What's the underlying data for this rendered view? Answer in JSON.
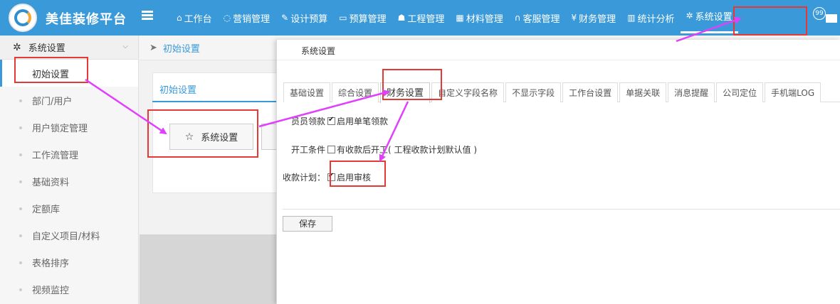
{
  "app": {
    "title": "美佳装修平台"
  },
  "nav": [
    {
      "label": "工作台",
      "icon": "home-icon",
      "glyph": "⌂"
    },
    {
      "label": "营销管理",
      "icon": "chat-icon",
      "glyph": "◌"
    },
    {
      "label": "设计预算",
      "icon": "edit-icon",
      "glyph": "✎"
    },
    {
      "label": "预算管理",
      "icon": "monitor-icon",
      "glyph": "▭"
    },
    {
      "label": "工程管理",
      "icon": "users-icon",
      "glyph": "☗"
    },
    {
      "label": "材料管理",
      "icon": "grid-icon",
      "glyph": "▦"
    },
    {
      "label": "客服管理",
      "icon": "headset-icon",
      "glyph": "∩"
    },
    {
      "label": "财务管理",
      "icon": "yen-icon",
      "glyph": "¥"
    },
    {
      "label": "统计分析",
      "icon": "bar-chart-icon",
      "glyph": "▥"
    },
    {
      "label": "系统设置",
      "icon": "gear-icon",
      "glyph": "✲"
    }
  ],
  "notifications": {
    "count": "99"
  },
  "sidebar": {
    "header": "系统设置",
    "items": [
      {
        "label": "初始设置"
      },
      {
        "label": "部门/用户"
      },
      {
        "label": "用户锁定管理"
      },
      {
        "label": "工作流管理"
      },
      {
        "label": "基础资料"
      },
      {
        "label": "定额库"
      },
      {
        "label": "自定义项目/材料"
      },
      {
        "label": "表格排序"
      },
      {
        "label": "视频监控"
      }
    ]
  },
  "breadcrumb": {
    "label": "初始设置"
  },
  "content": {
    "tab_label": "初始设置",
    "system_settings_button": "系统设置"
  },
  "modal": {
    "title": "系统设置",
    "tabs": [
      {
        "label": "基础设置"
      },
      {
        "label": "综合设置"
      },
      {
        "label": "财务设置"
      },
      {
        "label": "自定义字段名称"
      },
      {
        "label": "不显示字段"
      },
      {
        "label": "工作台设置"
      },
      {
        "label": "单据关联"
      },
      {
        "label": "消息提醒"
      },
      {
        "label": "公司定位"
      },
      {
        "label": "手机端LOG"
      }
    ],
    "active_tab": "财务设置",
    "rows": {
      "staff_advance": {
        "label": "员员领款",
        "checkbox_label": "启用单笔领款",
        "checked": true
      },
      "start_condition": {
        "label": "开工条件",
        "checkbox_label": "有收款后开工",
        "note": "( 工程收款计划默认值 )",
        "checked": false
      },
      "payment_plan": {
        "label": "收款计划：",
        "checkbox_label": "启用审核",
        "checked": true
      }
    },
    "save_label": "保存"
  },
  "colors": {
    "primary": "#3a9ad9",
    "annotation_box": "#e53935",
    "annotation_arrow": "#e040fb"
  }
}
